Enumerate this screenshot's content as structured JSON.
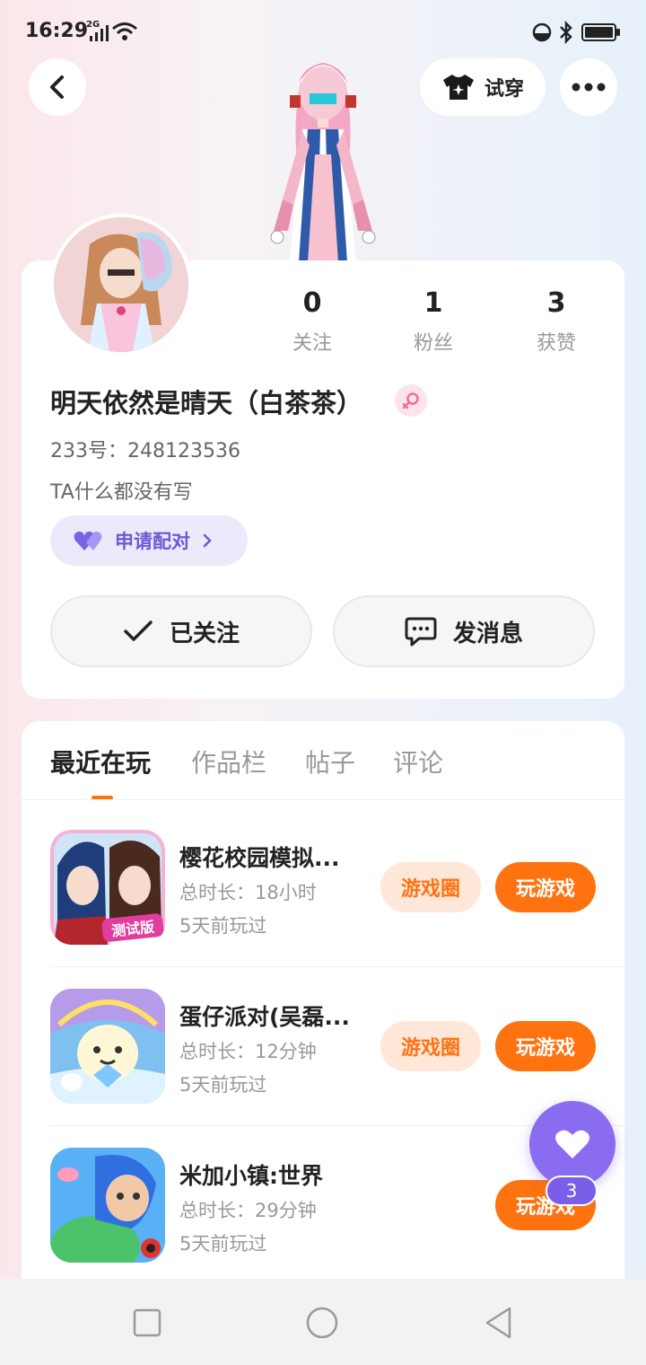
{
  "status_bar": {
    "time": "16:29",
    "network": "2G",
    "icons": [
      "signal-icon",
      "wifi-icon",
      "dnd-icon",
      "bluetooth-icon",
      "battery-icon"
    ]
  },
  "header": {
    "back_icon": "chevron-left-icon",
    "try_on_label": "试穿",
    "more_icon": "more-dots-icon"
  },
  "profile": {
    "stats": [
      {
        "value": "0",
        "label": "关注"
      },
      {
        "value": "1",
        "label": "粉丝"
      },
      {
        "value": "3",
        "label": "获赞"
      }
    ],
    "nickname": "明天依然是晴天（白茶茶）",
    "gender_icon": "female-icon",
    "uid": "233号：248123536",
    "bio": "TA什么都没有写",
    "pair_label": "申请配对",
    "follow_label": "已关注",
    "message_label": "发消息"
  },
  "tabs": [
    {
      "label": "最近在玩",
      "active": true
    },
    {
      "label": "作品栏",
      "active": false
    },
    {
      "label": "帖子",
      "active": false
    },
    {
      "label": "评论",
      "active": false
    }
  ],
  "games": [
    {
      "name": "樱花校园模拟...",
      "duration": "总时长：18小时",
      "last_played": "5天前玩过",
      "circle_label": "游戏圈",
      "play_label": "玩游戏"
    },
    {
      "name": "蛋仔派对(吴磊...",
      "duration": "总时长：12分钟",
      "last_played": "5天前玩过",
      "circle_label": "游戏圈",
      "play_label": "玩游戏"
    },
    {
      "name": "米加小镇:世界",
      "duration": "总时长：29分钟",
      "last_played": "5天前玩过",
      "circle_label": "",
      "play_label": "玩游戏"
    }
  ],
  "game_icon_badge": "测试版",
  "floating_like": {
    "count": "3"
  },
  "colors": {
    "accent_orange": "#ff7210",
    "accent_purple": "#8a6cf0",
    "pair_purple": "#6b5ad6"
  }
}
